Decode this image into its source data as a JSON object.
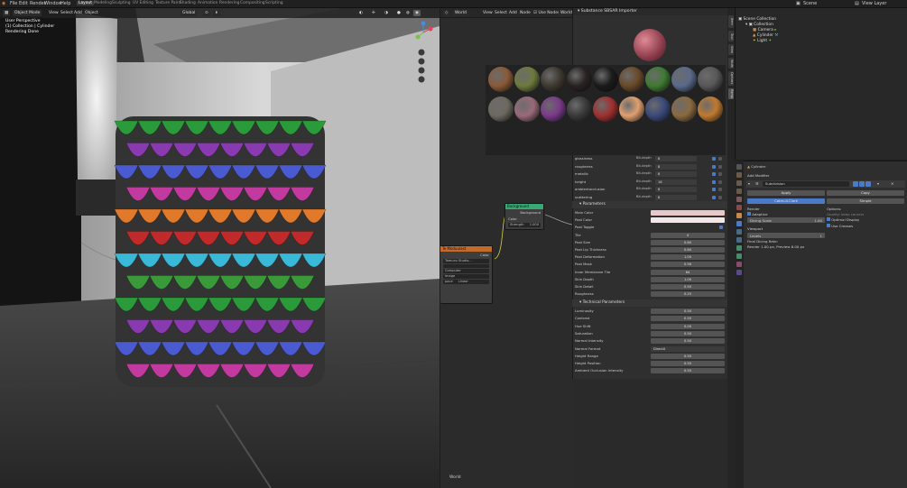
{
  "menu": {
    "items": [
      "File",
      "Edit",
      "Render",
      "Window",
      "Help"
    ],
    "workspaces": [
      "Layout",
      "Modeling",
      "Sculpting",
      "UV Editing",
      "Texture Paint",
      "Shading",
      "Animation",
      "Rendering",
      "Compositing",
      "Scripting"
    ],
    "active_workspace": "Layout",
    "scene_label": "Scene",
    "view_layer_label": "View Layer"
  },
  "viewport": {
    "mode": "Object Mode",
    "menus": [
      "View",
      "Select",
      "Add",
      "Object"
    ],
    "orientation": "Global",
    "overlay_lines": [
      "User Perspective",
      "(1) Collection | Cylinder",
      "Rendering Done"
    ]
  },
  "node_editor": {
    "type": "World",
    "menus": [
      "View",
      "Select",
      "Add",
      "Node"
    ],
    "use_nodes_label": "Use Nodes",
    "world_field": "World",
    "footer_label": "World",
    "background_node": {
      "title": "Background",
      "output": "Background",
      "color_label": "Color",
      "strength_label": "Strength",
      "strength_value": "1.000"
    },
    "texture_node": {
      "title": "Te Moduulast",
      "output": "Color",
      "field1": "Tamuco Studio...",
      "options": [
        "Computer",
        "Image",
        "Linear"
      ],
      "option_label": "pace"
    }
  },
  "substance": {
    "title": "Substance SBSAR Importer",
    "bake_rows": [
      {
        "label": "glossiness",
        "mid": "Bit-depth",
        "value": "8"
      },
      {
        "label": "roughness",
        "mid": "Bit-depth",
        "value": "8"
      },
      {
        "label": "metallic",
        "mid": "Bit-depth",
        "value": "8"
      },
      {
        "label": "height",
        "mid": "Bit-depth",
        "value": "16"
      },
      {
        "label": "ambientocclusion",
        "mid": "Bit-depth",
        "value": "8"
      },
      {
        "label": "scattering",
        "mid": "Bit-depth",
        "value": "8"
      }
    ],
    "parameters_header": "Parameters",
    "params": [
      {
        "label": "Main Color",
        "value": ""
      },
      {
        "label": "Post Color",
        "value": ""
      },
      {
        "label": "Post Toggle",
        "value": ""
      },
      {
        "label": "Tile",
        "value": "4"
      },
      {
        "label": "Post Size",
        "value": "0.60"
      },
      {
        "label": "Post Lip Thickness",
        "value": "0.60"
      },
      {
        "label": "Post Deformation",
        "value": "1.00"
      },
      {
        "label": "Post Mask",
        "value": "0.56"
      },
      {
        "label": "Inner Membrane Tile",
        "value": "64"
      },
      {
        "label": "Skin Depth",
        "value": "1.00"
      },
      {
        "label": "Skin Detail",
        "value": "0.50"
      },
      {
        "label": "Roughness",
        "value": "0.25"
      }
    ],
    "tech_header": "Technical Parameters",
    "tech_params": [
      {
        "label": "Luminosity",
        "value": "0.50"
      },
      {
        "label": "Contrast",
        "value": "0.50"
      },
      {
        "label": "Hue Shift",
        "value": "0.00"
      },
      {
        "label": "Saturation",
        "value": "0.50"
      },
      {
        "label": "Normal Intensity",
        "value": "0.50"
      },
      {
        "label": "Normal Format",
        "value": "DirectX"
      },
      {
        "label": "Height Range",
        "value": "0.50"
      },
      {
        "label": "Height Position",
        "value": "0.50"
      },
      {
        "label": "Ambient Occlusion Intensity",
        "value": "0.50"
      }
    ],
    "material_colors": [
      "#8a5a3a",
      "#6e7a3f",
      "#3f3a30",
      "#2a2222",
      "#1b1b1b",
      "#6a4a2a",
      "#3f7a32",
      "#5a6a8a",
      "#585858",
      "#6c6a60",
      "#9a6a7a",
      "#7a3a8a",
      "#3a3a3a",
      "#a03030",
      "#e0a070",
      "#3a4a7a",
      "#8a6a40",
      "#c07a30"
    ]
  },
  "side_tabs": [
    "Item",
    "Tool",
    "View",
    "Node",
    "Options",
    "Ramp"
  ],
  "outliner": {
    "root": "Scene Collection",
    "items": [
      "Collection",
      "Camera",
      "Cylinder",
      "Light"
    ]
  },
  "properties": {
    "object": "Cylinder",
    "add_modifier": "Add Modifier",
    "modifier_name": "Subdivision",
    "apply": "Apply",
    "copy": "Copy",
    "catmull": "Catmull-Clark",
    "simple": "Simple",
    "render_label": "Render",
    "adaptive_label": "Adaptive",
    "dicing_label": "Dicing Scale",
    "dicing_value": "1.00",
    "viewport_label": "Viewport",
    "levels_label": "Levels",
    "levels_value": "1",
    "options_label": "Options:",
    "quality_label": "Quality: keep corners",
    "optimal_display": "Optimal Display",
    "use_creases": "Use Creases",
    "final_dicing": "Final Dicing Rate:",
    "render_preview": "Render 1.00 px, Preview 8.00 px"
  }
}
